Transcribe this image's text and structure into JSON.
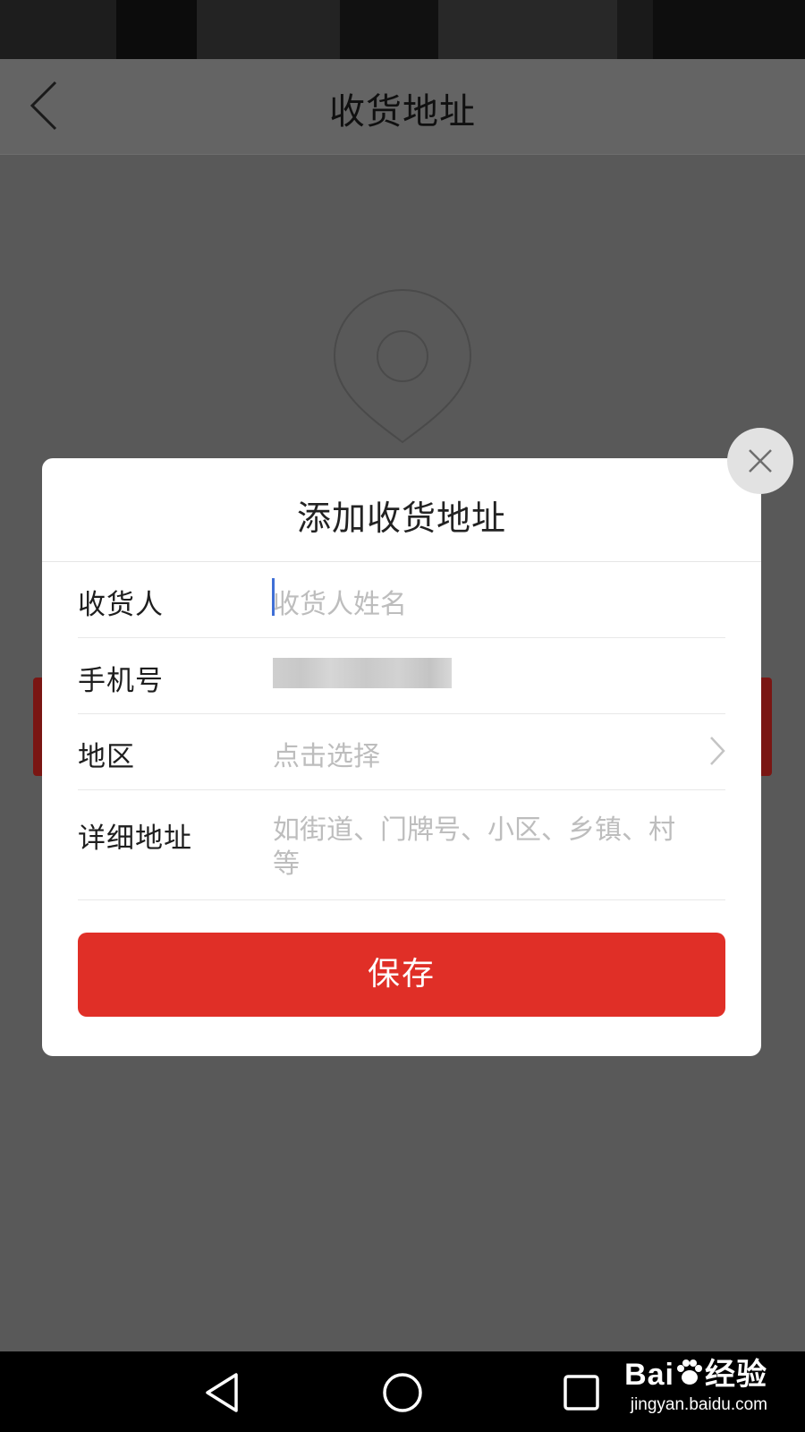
{
  "header": {
    "title": "收货地址"
  },
  "dialog": {
    "title": "添加收货地址",
    "fields": {
      "name": {
        "label": "收货人",
        "placeholder": "收货人姓名"
      },
      "phone": {
        "label": "手机号",
        "value": ""
      },
      "region": {
        "label": "地区",
        "placeholder": "点击选择"
      },
      "detail": {
        "label": "详细地址",
        "placeholder": "如街道、门牌号、小区、乡镇、村等"
      }
    },
    "save_label": "保存"
  },
  "watermark": {
    "brand_left": "Bai",
    "brand_right": "经验",
    "url": "jingyan.baidu.com"
  },
  "colors": {
    "accent": "#e02f27",
    "overlay": "#595959",
    "dialog_bg": "#ffffff",
    "placeholder": "#bdbdbd",
    "cursor": "#3f6fd6"
  }
}
